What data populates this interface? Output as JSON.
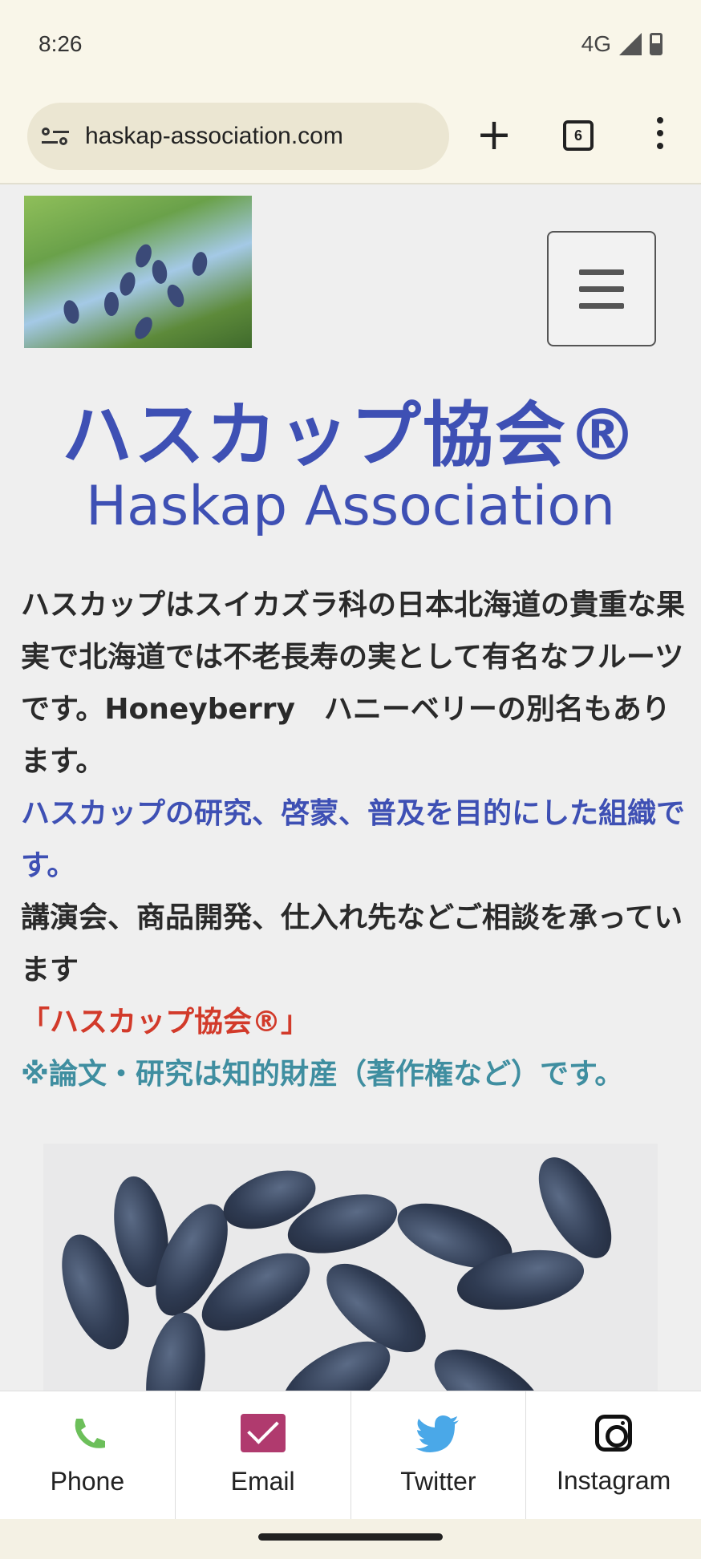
{
  "status_bar": {
    "time": "8:26",
    "network": "4G"
  },
  "browser": {
    "url": "haskap-association.com",
    "tab_count": "6"
  },
  "header": {
    "title_jp": "ハスカップ協会®",
    "title_en": "Haskap Association"
  },
  "intro": {
    "p1": "ハスカップはスイカズラ科の日本北海道の貴重な果実で北海道では不老長寿の実として有名なフルーツです。Honeyberry　ハニーベリーの別名もあります。",
    "p2": "ハスカップの研究、啓蒙、普及を目的にした組織です。",
    "p3": "講演会、商品開発、仕入れ先などご相談を承っています",
    "p4": "「ハスカップ協会®」",
    "p5": "※論文・研究は知的財産（著作権など）です。"
  },
  "contact": {
    "phone": "Phone",
    "email": "Email",
    "twitter": "Twitter",
    "instagram": "Instagram"
  },
  "colors": {
    "title_blue": "#3e50b4",
    "note_red": "#d23a2a",
    "note_teal": "#3f8ea0",
    "phone_green": "#6cbf5a",
    "email_magenta": "#b03a6e",
    "twitter_blue": "#4aa8e8"
  },
  "icons": [
    "tune-icon",
    "plus-icon",
    "tabs-icon",
    "more-vert-icon",
    "menu-icon",
    "phone-icon",
    "email-icon",
    "twitter-icon",
    "instagram-icon"
  ]
}
